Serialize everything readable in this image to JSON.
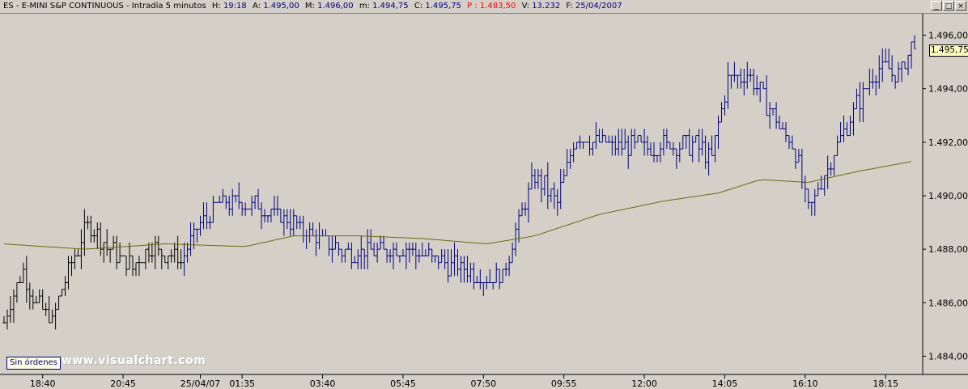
{
  "header": {
    "symbol": "ES - E-MINI S&P CONTINUOUS - Intradía 5 minutos",
    "h_label": "H:",
    "h_value": "19:18",
    "a_label": "A:",
    "a_value": "1.495,00",
    "m_label": "M:",
    "m_value": "1.496,00",
    "lo_label": "m:",
    "lo_value": "1.494,75",
    "c_label": "C:",
    "c_value": "1.495,75",
    "p_label": "P :",
    "p_value": "1.483,50",
    "v_label": "V:",
    "v_value": "13.232",
    "f_label": "F:",
    "f_value": "25/04/2007"
  },
  "window_buttons": [
    "_",
    "□",
    "×"
  ],
  "badge": "Sin órdenes",
  "watermark": "www.visualchart.com",
  "last_price_label": "1.495,75",
  "colors": {
    "background": "#d4d0c8",
    "price_bars_recent": "#000080",
    "price_bars_older": "#000000",
    "moving_average": "#6b6b10",
    "last_price_label_bg": "#ffffc0"
  },
  "chart_data": {
    "type": "ohlc",
    "title": "ES - E-MINI S&P CONTINUOUS - Intradía 5 minutos",
    "xlabel": "",
    "ylabel": "",
    "ylim": [
      1483.5,
      1496.5
    ],
    "grid": false,
    "y_ticks": [
      1496.0,
      1494.0,
      1492.0,
      1490.0,
      1488.0,
      1486.0,
      1484.0
    ],
    "y_tick_labels": [
      "1.496,00",
      "1.494,00",
      "1.492,00",
      "1.490,00",
      "1.488,00",
      "1.486,00",
      "1.484,00"
    ],
    "x_tick_labels": [
      "18:40",
      "20:45",
      "25/04/07",
      "01:35",
      "03:40",
      "05:45",
      "07:50",
      "09:55",
      "12:00",
      "14:05",
      "16:10",
      "18:15"
    ],
    "x_tick_positions": [
      12,
      37,
      61,
      74,
      99,
      124,
      149,
      174,
      199,
      224,
      249,
      274
    ],
    "num_bars": 284,
    "price_path": [
      [
        0,
        1485.3
      ],
      [
        6,
        1487.2
      ],
      [
        10,
        1486.0
      ],
      [
        15,
        1485.3
      ],
      [
        20,
        1487.2
      ],
      [
        26,
        1488.9
      ],
      [
        33,
        1488.0
      ],
      [
        40,
        1487.3
      ],
      [
        45,
        1488.0
      ],
      [
        50,
        1487.9
      ],
      [
        55,
        1487.6
      ],
      [
        60,
        1488.7
      ],
      [
        68,
        1489.8
      ],
      [
        80,
        1489.6
      ],
      [
        95,
        1488.6
      ],
      [
        105,
        1488.0
      ],
      [
        115,
        1487.9
      ],
      [
        125,
        1488.0
      ],
      [
        135,
        1487.6
      ],
      [
        150,
        1486.9
      ],
      [
        155,
        1487.0
      ],
      [
        160,
        1489.0
      ],
      [
        165,
        1490.7
      ],
      [
        172,
        1489.8
      ],
      [
        178,
        1492.3
      ],
      [
        190,
        1491.8
      ],
      [
        205,
        1491.9
      ],
      [
        215,
        1491.9
      ],
      [
        220,
        1491.4
      ],
      [
        225,
        1494.4
      ],
      [
        232,
        1494.5
      ],
      [
        240,
        1492.8
      ],
      [
        246,
        1491.7
      ],
      [
        250,
        1489.4
      ],
      [
        257,
        1491.4
      ],
      [
        265,
        1493.4
      ],
      [
        272,
        1494.8
      ],
      [
        278,
        1494.5
      ],
      [
        283,
        1495.75
      ]
    ],
    "moving_average_path": [
      [
        0,
        1488.2
      ],
      [
        25,
        1488.0
      ],
      [
        50,
        1488.2
      ],
      [
        75,
        1488.1
      ],
      [
        90,
        1488.5
      ],
      [
        110,
        1488.5
      ],
      [
        130,
        1488.4
      ],
      [
        150,
        1488.2
      ],
      [
        165,
        1488.5
      ],
      [
        185,
        1489.3
      ],
      [
        205,
        1489.8
      ],
      [
        222,
        1490.1
      ],
      [
        235,
        1490.6
      ],
      [
        250,
        1490.5
      ],
      [
        265,
        1490.9
      ],
      [
        283,
        1491.3
      ]
    ],
    "last_close": 1495.75
  }
}
